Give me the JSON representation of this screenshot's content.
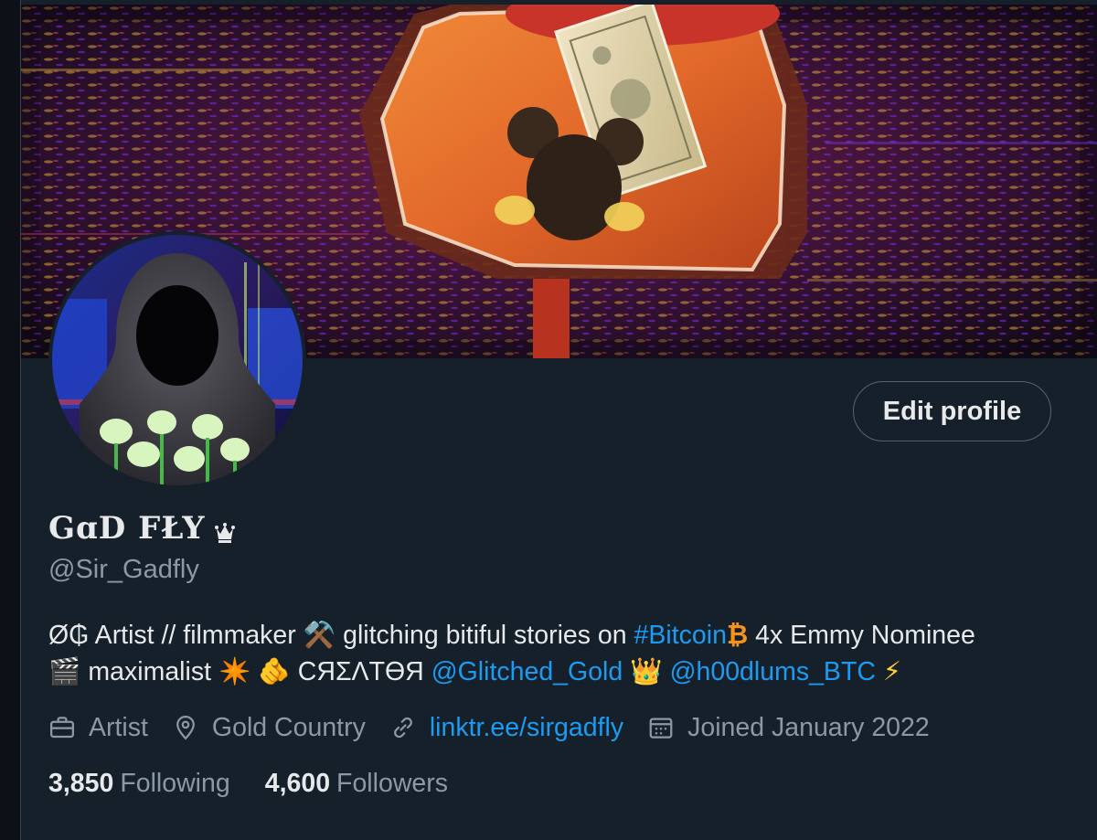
{
  "profile": {
    "display_name": "GɑD FŁY",
    "handle": "@Sir_Gadfly",
    "edit_button": "Edit profile",
    "bio": {
      "line1": [
        {
          "type": "text",
          "value": "Ø₲ Artist // filmmaker "
        },
        {
          "type": "emoji",
          "value": "⚒️"
        },
        {
          "type": "text",
          "value": " glitching bitiful stories on "
        },
        {
          "type": "link",
          "value": "#Bitcoin"
        },
        {
          "type": "emoji",
          "value": "₿"
        },
        {
          "type": "text",
          "value": "  4x Emmy Nominee"
        }
      ],
      "line2": [
        {
          "type": "emoji",
          "value": "🎬"
        },
        {
          "type": "text",
          "value": " maximalist "
        },
        {
          "type": "emoji",
          "value": "✴️"
        },
        {
          "type": "text",
          "value": " "
        },
        {
          "type": "emoji",
          "value": "🫵"
        },
        {
          "type": "text",
          "value": " СЯΣΛТӨЯ "
        },
        {
          "type": "link",
          "value": "@Glitched_Gold"
        },
        {
          "type": "text",
          "value": " "
        },
        {
          "type": "emoji",
          "value": "👑"
        },
        {
          "type": "text",
          "value": " "
        },
        {
          "type": "link",
          "value": "@h00dlums_BTC"
        },
        {
          "type": "text",
          "value": " "
        },
        {
          "type": "emoji",
          "value": "⚡"
        }
      ]
    },
    "meta": {
      "profession": "Artist",
      "location": "Gold Country",
      "website": "linktr.ee/sirgadfly",
      "joined": "Joined January 2022"
    },
    "stats": {
      "following_count": "3,850",
      "following_label": "Following",
      "followers_count": "4,600",
      "followers_label": "Followers"
    }
  },
  "icons": {
    "crown": "crown-icon",
    "profession": "briefcase-icon",
    "location": "location-pin-icon",
    "website": "link-icon",
    "joined": "calendar-icon"
  },
  "colors": {
    "background": "#15202b",
    "page_margin": "#0d1117",
    "text_primary": "#e7e9ea",
    "text_secondary": "#8b98a5",
    "link": "#1d9bf0",
    "button_border": "#536471"
  }
}
